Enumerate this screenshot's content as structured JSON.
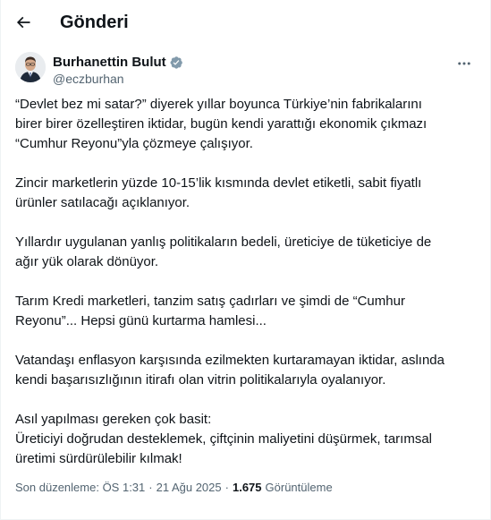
{
  "header": {
    "title": "Gönderi"
  },
  "post": {
    "author": {
      "display_name": "Burhanettin Bulut",
      "handle": "@eczburhan",
      "verified": true
    },
    "paragraphs": [
      [
        "“Devlet bez mi satar?” diyerek yıllar boyunca Türkiye’nin fabrikalarını",
        "birer birer özelleştiren iktidar, bugün kendi yarattığı ekonomik çıkmazı",
        "“Cumhur Reyonu”yla çözmeye çalışıyor."
      ],
      [
        "Zincir marketlerin yüzde 10-15’lik kısmında devlet etiketli, sabit fiyatlı",
        "ürünler satılacağı açıklanıyor."
      ],
      [
        "Yıllardır uygulanan yanlış politikaların bedeli, üreticiye de tüketiciye de",
        "ağır yük olarak dönüyor."
      ],
      [
        "Tarım Kredi marketleri, tanzim satış çadırları ve şimdi de “Cumhur",
        "Reyonu”... Hepsi günü kurtarma hamlesi..."
      ],
      [
        "Vatandaşı enflasyon karşısında ezilmekten kurtaramayan iktidar, aslında",
        "kendi başarısızlığının itirafı olan vitrin politikalarıyla oyalanıyor."
      ],
      [
        "Asıl yapılması gereken çok basit:",
        "Üreticiyi doğrudan desteklemek, çiftçinin maliyetini düşürmek, tarımsal",
        "üretimi sürdürülebilir kılmak!"
      ]
    ],
    "meta": {
      "edited_label": "Son düzenleme: ÖS 1:31",
      "separator": "·",
      "date": "21 Ağu 2025",
      "views_count": "1.675",
      "views_label": "Görüntüleme"
    }
  },
  "colors": {
    "text": "#0f1419",
    "secondary": "#536471",
    "verified": "#829aab"
  }
}
